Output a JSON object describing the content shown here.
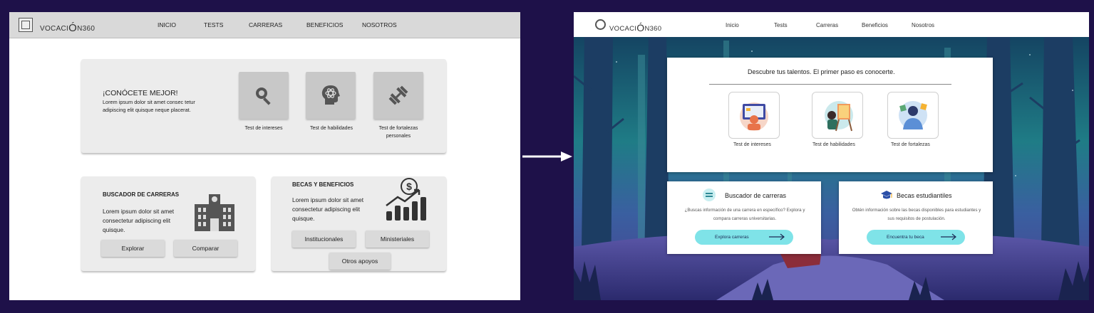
{
  "wireframe": {
    "logo": {
      "prefix": "VOCACI",
      "big": "Ó",
      "suffix": "N360"
    },
    "nav": [
      "INICIO",
      "TESTS",
      "CARRERAS",
      "BENEFICIOS",
      "NOSOTROS"
    ],
    "know": {
      "title": "¡CONÓCETE MEJOR!",
      "body": "Lorem ipsum dolor sit amet consec tetur adipiscing elit quisque neque placerat.",
      "tests": [
        "Test de intereses",
        "Test de habilidades",
        "Test de fortalezas personales"
      ]
    },
    "careers": {
      "title": "BUSCADOR DE CARRERAS",
      "body": "Lorem ipsum dolor sit amet consectetur adipiscing elit quisque.",
      "buttons": [
        "Explorar",
        "Comparar"
      ]
    },
    "benefits": {
      "title": "BECAS Y BENEFICIOS",
      "body": "Lorem ipsum dolor sit amet consectetur adipiscing elit quisque.",
      "buttons": [
        "Institucionales",
        "Ministeriales",
        "Otros apoyos"
      ]
    }
  },
  "design": {
    "logo": {
      "prefix": "VOCACI",
      "big": "Ó",
      "suffix": "N360"
    },
    "nav": [
      "Inicio",
      "Tests",
      "Carreras",
      "Beneficios",
      "Nosotros"
    ],
    "headline": "Descubre tus talentos. El primer paso es conocerte.",
    "tests": [
      "Test de intereses",
      "Test de habilidades",
      "Test de fortalezas"
    ],
    "careers": {
      "title": "Buscador de carreras",
      "body": "¿Buscas información de una carrera en específico? Explora y compara carreras universitarias.",
      "button": "Explora carreras"
    },
    "scholarships": {
      "title": "Becas estudiantiles",
      "body": "Obtén información sobre las becas disponibles para estudiantes y sus requisitos de postulación.",
      "button": "Encuentra tu beca"
    },
    "colors": {
      "accent": "#7fe3e8",
      "background": "#1e1149"
    }
  }
}
